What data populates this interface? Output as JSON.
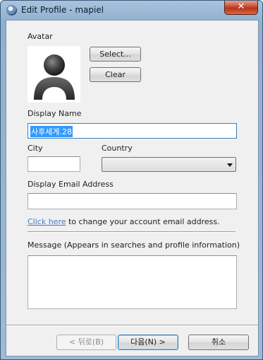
{
  "window": {
    "title": "Edit Profile - mapiel",
    "close_glyph": "✕"
  },
  "avatar": {
    "label": "Avatar",
    "select_button": "Select...",
    "clear_button": "Clear",
    "image_icon": "default-user-silhouette"
  },
  "display_name": {
    "label": "Display Name",
    "value": "사후세계.28"
  },
  "city": {
    "label": "City",
    "value": ""
  },
  "country": {
    "label": "Country",
    "value": ""
  },
  "email": {
    "label": "Display Email Address",
    "value": "",
    "link_text": "Click here",
    "link_suffix": " to change your account email address."
  },
  "message": {
    "label": "Message (Appears in searches and profile information)",
    "value": ""
  },
  "footer": {
    "back_button": "< 뒤로(B)",
    "next_button": "다음(N) >",
    "cancel_button": "취소"
  },
  "colors": {
    "link": "#4b79c8",
    "selection": "#3399ff",
    "dialog_bg": "#f0f0f0"
  }
}
